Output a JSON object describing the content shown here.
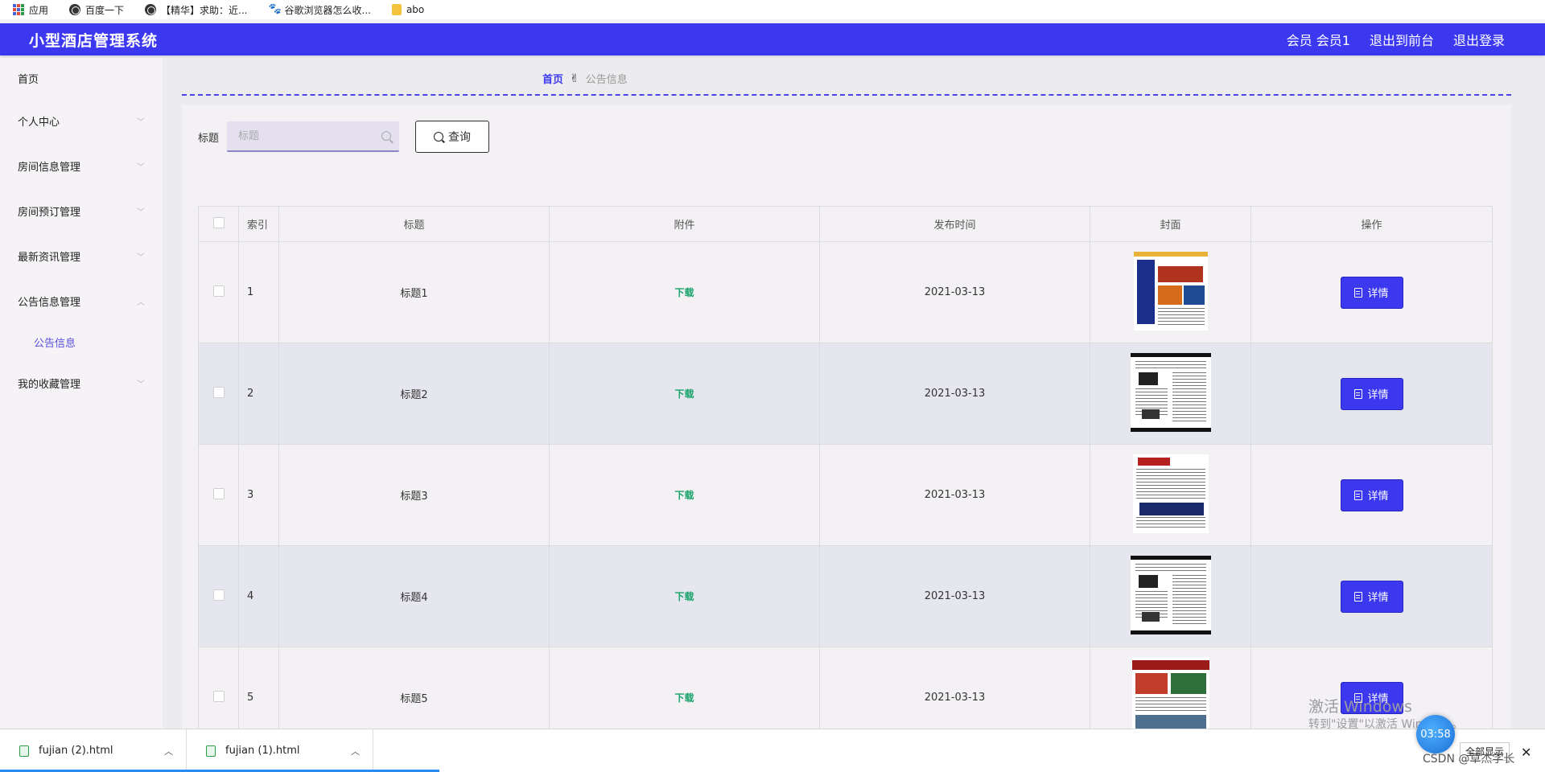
{
  "bookmarks": [
    {
      "label": "应用",
      "icon": "apps-grid-icon"
    },
    {
      "label": "百度一下",
      "icon": "globe-icon"
    },
    {
      "label": "【精华】求助：近...",
      "icon": "globe-icon"
    },
    {
      "label": "谷歌浏览器怎么收...",
      "icon": "paw-icon"
    },
    {
      "label": "abo",
      "icon": "folder-icon"
    }
  ],
  "header": {
    "title": "小型酒店管理系统",
    "user": "会员 会员1",
    "back_front": "退出到前台",
    "logout": "退出登录",
    "color": "#3b38f0"
  },
  "sidebar": {
    "items": [
      {
        "label": "首页"
      },
      {
        "label": "个人中心",
        "chevron": "﹀"
      },
      {
        "label": "房间信息管理",
        "chevron": "﹀"
      },
      {
        "label": "房间预订管理",
        "chevron": "﹀"
      },
      {
        "label": "最新资讯管理",
        "chevron": "﹀"
      },
      {
        "label": "公告信息管理",
        "chevron": "︿"
      },
      {
        "label": "公告信息"
      },
      {
        "label": "我的收藏管理",
        "chevron": "﹀"
      }
    ]
  },
  "breadcrumb": {
    "home": "首页",
    "separator": "✌",
    "current": "公告信息"
  },
  "search": {
    "label": "标题",
    "placeholder": "标题",
    "value": "",
    "button": "查询"
  },
  "table": {
    "headers": {
      "index": "索引",
      "title": "标题",
      "attachment": "附件",
      "time": "发布时间",
      "cover": "封面",
      "action": "操作"
    },
    "rows": [
      {
        "index": "1",
        "title": "标题1",
        "attachment": "下载",
        "time": "2021-03-13",
        "action": "详情"
      },
      {
        "index": "2",
        "title": "标题2",
        "attachment": "下载",
        "time": "2021-03-13",
        "action": "详情"
      },
      {
        "index": "3",
        "title": "标题3",
        "attachment": "下载",
        "time": "2021-03-13",
        "action": "详情"
      },
      {
        "index": "4",
        "title": "标题4",
        "attachment": "下载",
        "time": "2021-03-13",
        "action": "详情"
      },
      {
        "index": "5",
        "title": "标题5",
        "attachment": "下载",
        "time": "2021-03-13",
        "action": "详情"
      }
    ]
  },
  "watermark": {
    "line1": "激活 Windows",
    "line2": "转到\"设置\"以激活 Windows。"
  },
  "downloads": [
    {
      "name": "fujian (2).html"
    },
    {
      "name": "fujian (1).html"
    }
  ],
  "overlay": {
    "timer": "03:58",
    "fullscreen": "全部显示",
    "csdn": "CSDN @草杰学长"
  }
}
